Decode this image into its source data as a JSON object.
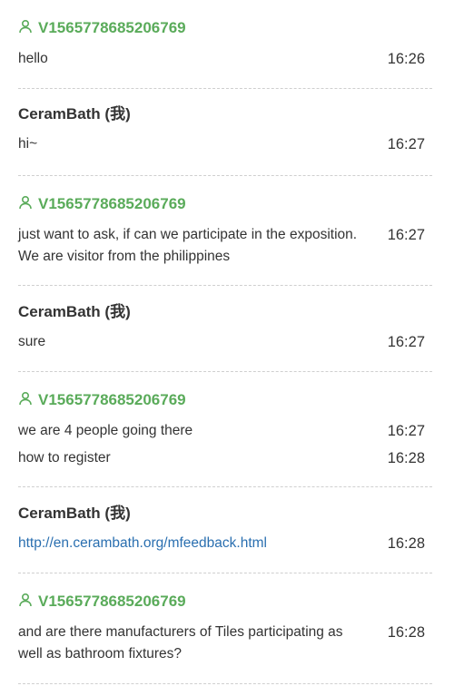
{
  "conversation": [
    {
      "sender": "V1565778685206769",
      "role": "visitor",
      "messages": [
        {
          "text": "hello",
          "time": "16:26"
        }
      ]
    },
    {
      "sender": "CeramBath (我)",
      "role": "staff",
      "messages": [
        {
          "text": "hi~",
          "time": "16:27"
        }
      ]
    },
    {
      "sender": "V1565778685206769",
      "role": "visitor",
      "messages": [
        {
          "text": "just want to ask, if can we participate in the exposition. We are visitor from the philippines",
          "time": "16:27"
        }
      ]
    },
    {
      "sender": "CeramBath (我)",
      "role": "staff",
      "messages": [
        {
          "text": "sure",
          "time": "16:27"
        }
      ]
    },
    {
      "sender": "V1565778685206769",
      "role": "visitor",
      "messages": [
        {
          "text": "we are 4 people going there",
          "time": "16:27"
        },
        {
          "text": "how to register",
          "time": "16:28"
        }
      ]
    },
    {
      "sender": "CeramBath (我)",
      "role": "staff",
      "messages": [
        {
          "text": "http://en.cerambath.org/mfeedback.html",
          "time": "16:28",
          "link": true
        }
      ]
    },
    {
      "sender": "V1565778685206769",
      "role": "visitor",
      "messages": [
        {
          "text": "and are there manufacturers of Tiles participating as well as bathroom fixtures?",
          "time": "16:28"
        }
      ]
    }
  ],
  "colors": {
    "visitor_name": "#5aab5a",
    "staff_name": "#333333",
    "link": "#2a6fb0",
    "divider": "#cfcfcf"
  },
  "icons": {
    "visitor": "user-icon"
  }
}
